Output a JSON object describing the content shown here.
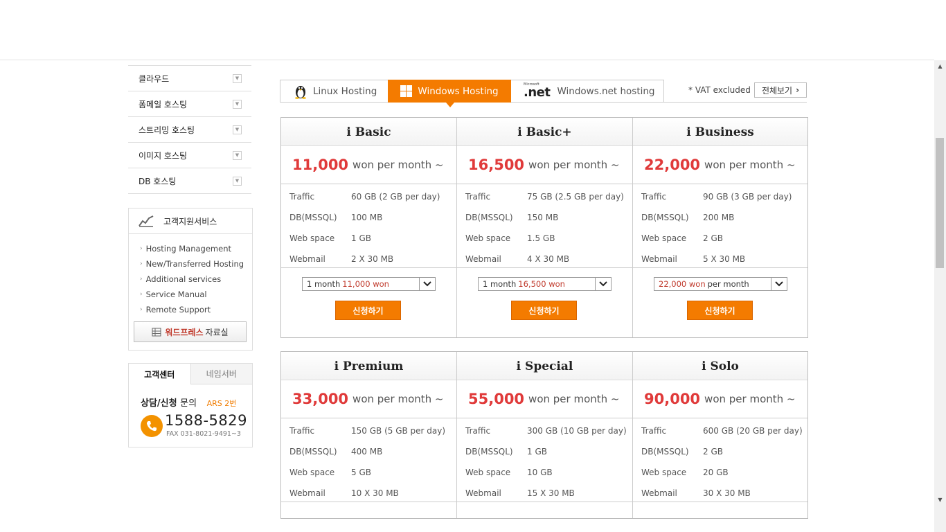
{
  "sidebar": {
    "menu": [
      {
        "label": "클라우드"
      },
      {
        "label": "폼메일 호스팅"
      },
      {
        "label": "스트리밍 호스팅"
      },
      {
        "label": "이미지 호스팅"
      },
      {
        "label": "DB 호스팅"
      }
    ],
    "support": {
      "title": "고객지원서비스",
      "items": [
        "Hosting Management",
        "New/Transferred Hosting",
        "Additional services",
        "Service Manual",
        "Remote Support"
      ],
      "wordpress_highlight": "워드프레스",
      "wordpress_rest": "자료실"
    },
    "customer_center": {
      "tab_active": "고객센터",
      "tab_inactive": "네임서버",
      "consult_bold": "상담/신청",
      "consult_rest": "문의",
      "ars": "ARS 2번",
      "phone": "1588-5829",
      "fax": "FAX 031-8021-9491~3"
    }
  },
  "main": {
    "tabs": {
      "linux": "Linux Hosting",
      "windows": "Windows Hosting",
      "net_logo_small": "Microsoft",
      "net_logo": ".net",
      "net": "Windows.net hosting"
    },
    "vat_note": "* VAT excluded",
    "view_all": "전체보기",
    "price_unit": "won per month ~",
    "spec_labels": {
      "traffic": "Traffic",
      "db": "DB(MSSQL)",
      "web": "Web space",
      "mail": "Webmail"
    },
    "apply_label": "신청하기",
    "plans": [
      {
        "name": "i Basic",
        "price": "11,000",
        "traffic": "60 GB (2 GB per day)",
        "db": "100 MB",
        "web": "1 GB",
        "mail": "2 X 30 MB",
        "sel_pre": "1 month",
        "sel_red": "11,000 won",
        "sel_post": ""
      },
      {
        "name": "i Basic+",
        "price": "16,500",
        "traffic": "75 GB (2.5 GB per day)",
        "db": "150 MB",
        "web": "1.5 GB",
        "mail": "4 X 30 MB",
        "sel_pre": "1 month",
        "sel_red": "16,500 won",
        "sel_post": ""
      },
      {
        "name": "i Business",
        "price": "22,000",
        "traffic": "90 GB (3 GB per day)",
        "db": "200 MB",
        "web": "2 GB",
        "mail": "5 X 30 MB",
        "sel_pre": "",
        "sel_red": "22,000 won",
        "sel_post": "per month"
      },
      {
        "name": "i Premium",
        "price": "33,000",
        "traffic": "150 GB (5 GB per day)",
        "db": "400 MB",
        "web": "5 GB",
        "mail": "10 X 30 MB"
      },
      {
        "name": "i Special",
        "price": "55,000",
        "traffic": "300 GB (10 GB per day)",
        "db": "1 GB",
        "web": "10 GB",
        "mail": "15 X 30 MB"
      },
      {
        "name": "i Solo",
        "price": "90,000",
        "traffic": "600 GB (20 GB per day)",
        "db": "2 GB",
        "web": "20 GB",
        "mail": "30 X 30 MB"
      }
    ]
  }
}
